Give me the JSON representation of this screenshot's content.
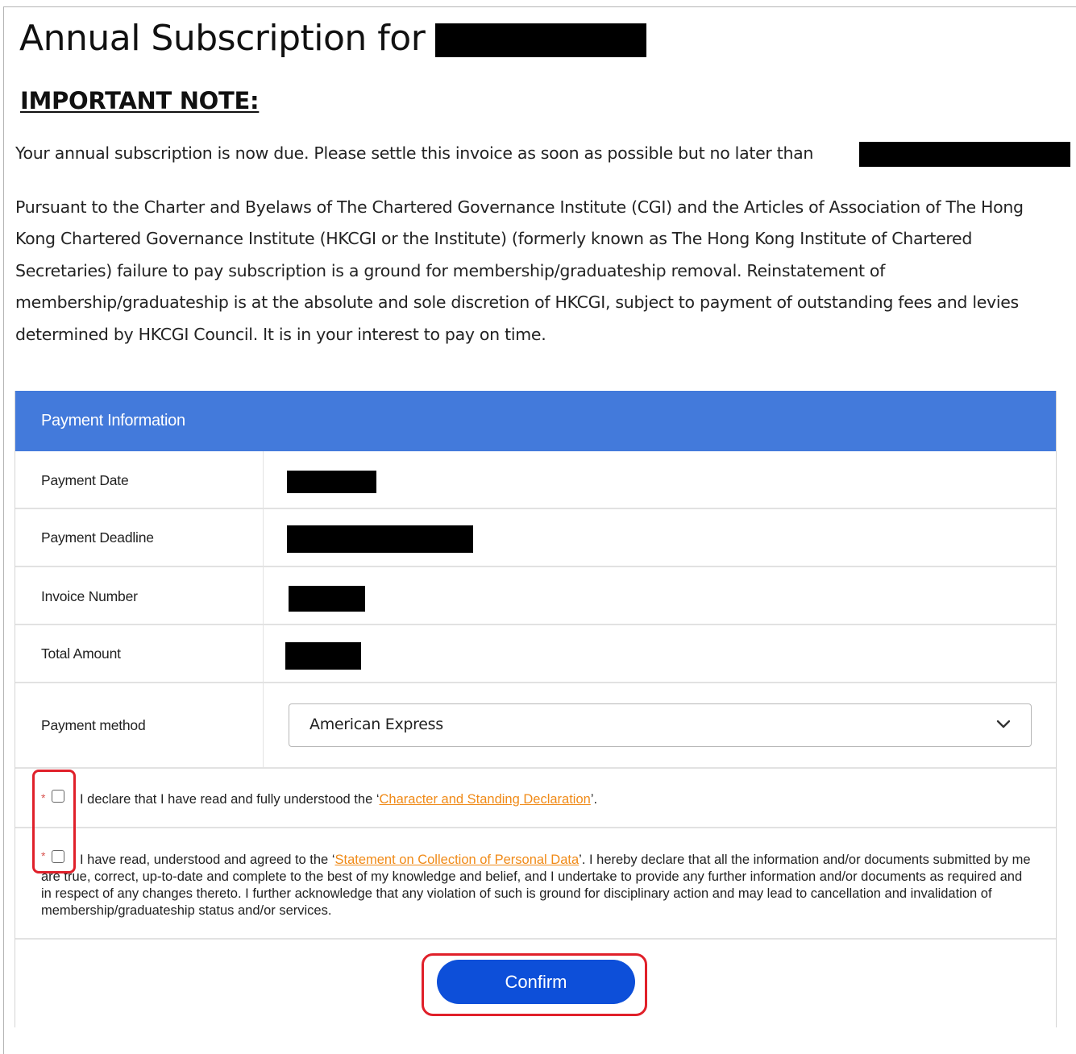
{
  "page": {
    "title": "Annual Subscription for",
    "important_note": "IMPORTANT NOTE:",
    "due_text": "Your annual subscription is now due. Please settle this invoice as soon as possible but no later than",
    "legal_text": "Pursuant to the Charter and Byelaws of The Chartered Governance Institute (CGI) and the Articles of Association of The Hong Kong Chartered Governance Institute (HKCGI or the Institute) (formerly known as The Hong Kong Institute of Chartered Secretaries) failure to pay subscription is a ground for membership/graduateship removal. Reinstatement of membership/graduateship is at the absolute and sole discretion of HKCGI, subject to payment of outstanding fees and levies determined by HKCGI Council. It is in your interest to pay on time."
  },
  "payment": {
    "header": "Payment Information",
    "rows": [
      {
        "label": "Payment Date"
      },
      {
        "label": "Payment Deadline"
      },
      {
        "label": "Invoice Number"
      },
      {
        "label": "Total Amount"
      }
    ],
    "method_label": "Payment method",
    "method_value": "American Express"
  },
  "declarations": {
    "asterisk": "*",
    "d1_prefix": "I declare that I have read and fully understood the ‘",
    "d1_link": "Character and Standing Declaration",
    "d1_suffix": "’.",
    "d2_prefix": "I have read, understood and agreed to the ‘",
    "d2_link": "Statement on Collection of Personal Data",
    "d2_suffix": "’. I hereby declare that all the information and/or documents submitted by me are true, correct, up-to-date and complete to the best of my knowledge and belief, and I undertake to provide any further information and/or documents as required and in respect of any changes thereto. I further acknowledge that any violation of such is ground for disciplinary action and may lead to cancellation and invalidation of membership/graduateship status and/or services."
  },
  "actions": {
    "confirm_label": "Confirm"
  },
  "colors": {
    "header_blue": "#437adb",
    "button_blue": "#0d4fd9",
    "link_orange": "#f08a17",
    "highlight_red": "#e0202a"
  }
}
